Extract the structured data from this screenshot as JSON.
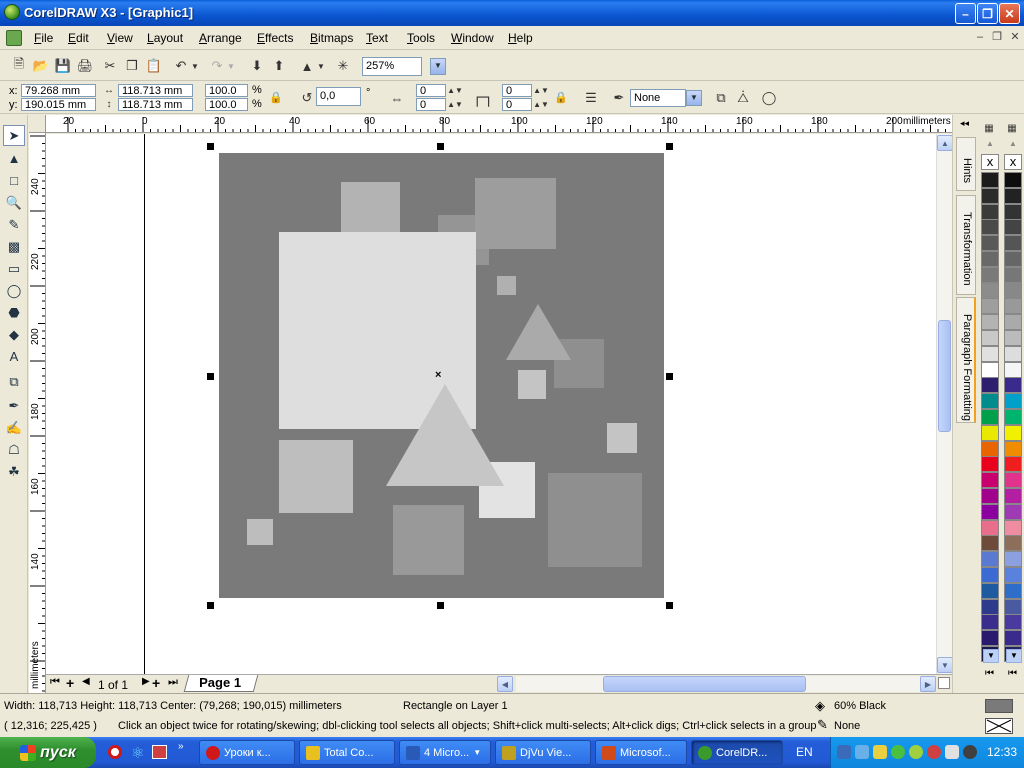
{
  "window": {
    "title": "CorelDRAW X3 - [Graphic1]"
  },
  "menu": [
    "File",
    "Edit",
    "View",
    "Layout",
    "Arrange",
    "Effects",
    "Bitmaps",
    "Text",
    "Tools",
    "Window",
    "Help"
  ],
  "standard_toolbar": {
    "zoom": "257%"
  },
  "property_bar": {
    "x_label": "x:",
    "x_value": "79.268 mm",
    "y_label": "y:",
    "y_value": "190.015 mm",
    "width_value": "118.713 mm",
    "height_value": "118.713 mm",
    "scale_x": "100.0",
    "scale_y": "100.0",
    "percent": "%",
    "rotation": "0,0",
    "degree": "°",
    "corner_tl": "0",
    "corner_bl": "0",
    "corner_tr": "0",
    "corner_br": "0",
    "outline_width": "None"
  },
  "rulers": {
    "top": [
      "20",
      "0",
      "20",
      "40",
      "60",
      "80",
      "100",
      "120",
      "140",
      "160",
      "180",
      "200"
    ],
    "top_unit": "millimeters",
    "left": [
      "240",
      "220",
      "200",
      "180",
      "160",
      "140"
    ],
    "left_unit": "millimeters"
  },
  "page_nav": {
    "counter": "1 of 1",
    "tab": "Page 1"
  },
  "dockers": {
    "hints": "Hints",
    "transformation": "Transformation",
    "paragraph": "Paragraph Formatting"
  },
  "palette": {
    "col1": [
      "#1c1c1c",
      "#2b2b2b",
      "#3a3a3a",
      "#4a4a4a",
      "#595959",
      "#696969",
      "#7a7a7a",
      "#8c8c8c",
      "#9e9e9e",
      "#b3b3b3",
      "#c8c8c8",
      "#e0e0e0",
      "#ffffff",
      "#2e1f6e",
      "#008c8c",
      "#00a04a",
      "#e8e800",
      "#e86400",
      "#e8001e",
      "#c8006e",
      "#a0008c",
      "#8c00a0",
      "#e86e8c",
      "#6e4a3a",
      "#5a7ad2",
      "#3a6ad2",
      "#1e5aa0",
      "#2e3a8c",
      "#3a2e8c",
      "#2a1a6e",
      "#1a1a4a"
    ],
    "col2": [
      "#0d0d0d",
      "#222222",
      "#333333",
      "#444444",
      "#555555",
      "#666666",
      "#777777",
      "#888888",
      "#999999",
      "#aaaaaa",
      "#bbbbbb",
      "#dddddd",
      "#f5f5f5",
      "#3a2a8c",
      "#00a0c8",
      "#00b46e",
      "#f0f000",
      "#f08c00",
      "#f01e1e",
      "#e0348c",
      "#b41ea0",
      "#a03ab4",
      "#f08ca0",
      "#8c6e5a",
      "#8ca0e0",
      "#5a82dc",
      "#2e6ec8",
      "#4a5aa0",
      "#4a3aa0",
      "#3a2a8c",
      "#222260"
    ],
    "picks": [
      "x",
      "x"
    ]
  },
  "status": {
    "dimensions": "Width: 118,713  Height: 118,713  Center: (79,268; 190,015)  millimeters",
    "object": "Rectangle on Layer 1",
    "fill": "60% Black",
    "cursor": "( 12,316; 225,425 )",
    "hint": "Click an object twice for rotating/skewing; dbl-clicking tool selects all objects; Shift+click multi-selects; Alt+click digs; Ctrl+click selects in a group",
    "outline": "None"
  },
  "taskbar": {
    "start": "пуск",
    "tasks": [
      {
        "label": "Уроки к...",
        "color": "#d01818"
      },
      {
        "label": "Total Co...",
        "color": "#e8c020"
      },
      {
        "label": "4 Micro...",
        "color": "#2a5ab8"
      },
      {
        "label": "DjVu Vie...",
        "color": "#c0a020"
      },
      {
        "label": "Microsof...",
        "color": "#d04a1a"
      },
      {
        "label": "CorelDR...",
        "color": "#3a9a2a"
      }
    ],
    "lang": "EN",
    "clock": "12:33"
  }
}
